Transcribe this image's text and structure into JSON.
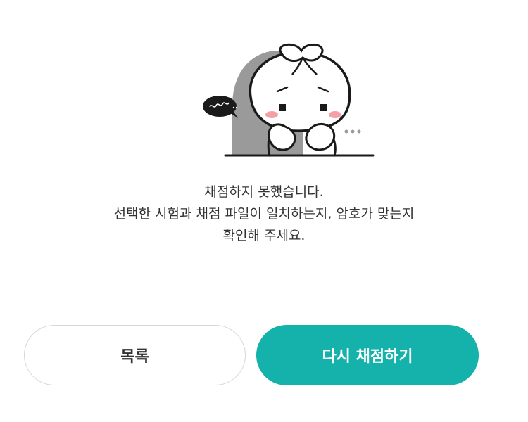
{
  "illustration": {
    "icon": "sad-character-illustration",
    "speech_bubble_icon": "sigh-speech-bubble-icon"
  },
  "message": {
    "line1": "채점하지 못했습니다.",
    "line2": "선택한 시험과 채점 파일이 일치하는지, 암호가 맞는지",
    "line3": "확인해 주세요."
  },
  "actions": {
    "list_label": "목록",
    "retry_label": "다시 채점하기"
  },
  "colors": {
    "primary": "#14b2aa",
    "text": "#333333",
    "border": "#d7d7d7"
  }
}
